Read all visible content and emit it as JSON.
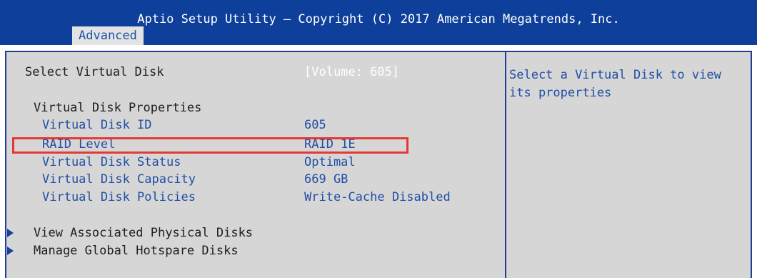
{
  "header": {
    "title": "Aptio Setup Utility – Copyright (C) 2017 American Megatrends, Inc.",
    "active_tab": "Advanced"
  },
  "main": {
    "select_virtual_disk": {
      "label": "Select Virtual Disk",
      "value": "[Volume: 605]"
    },
    "section_heading": "Virtual Disk Properties",
    "properties": [
      {
        "label": "Virtual Disk ID",
        "value": "605"
      },
      {
        "label": "RAID Level",
        "value": "RAID 1E"
      },
      {
        "label": "Virtual Disk Status",
        "value": "Optimal"
      },
      {
        "label": "Virtual Disk Capacity",
        "value": "669 GB"
      },
      {
        "label": "Virtual Disk Policies",
        "value": "Write-Cache Disabled"
      }
    ],
    "submenus": [
      {
        "label": "View Associated Physical Disks"
      },
      {
        "label": "Manage Global Hotspare Disks"
      }
    ]
  },
  "help_panel": {
    "text": "Select a Virtual Disk to view its properties"
  },
  "colors": {
    "header_bg": "#0e3f9a",
    "panel_bg": "#d6d6d6",
    "border": "#1e3f98",
    "text_blue": "#214fa3",
    "highlight_box": "#e53935"
  },
  "icons": {
    "submenu_arrow": "triangle-right-icon"
  }
}
